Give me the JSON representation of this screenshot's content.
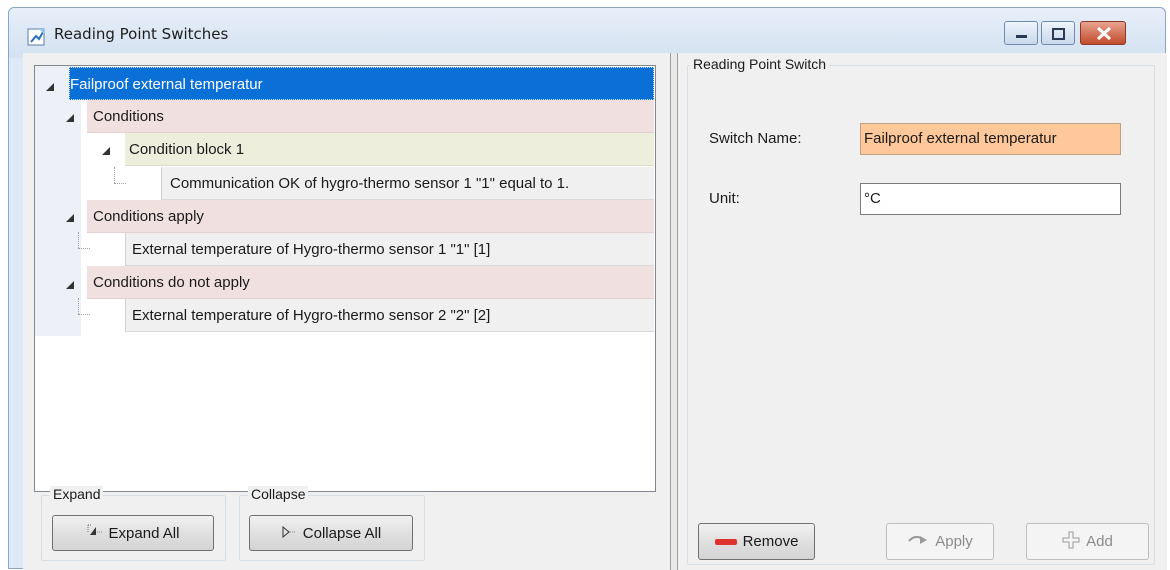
{
  "window": {
    "title": "Reading Point Switches",
    "colors": {
      "selection": "#0a6fd6",
      "condition_row": "#f1e0e0",
      "block_row": "#eeeedd",
      "name_highlight": "#ffc89a"
    }
  },
  "tree": {
    "root": "Failproof external temperatur",
    "conditions": "Conditions",
    "condition_block": "Condition block 1",
    "condition_item": "Communication OK of hygro-thermo sensor 1 \"1\" equal to 1.",
    "conditions_apply": "Conditions apply",
    "apply_item": "External temperature of Hygro-thermo sensor 1 \"1\" [1]",
    "conditions_not_apply": "Conditions do not apply",
    "not_apply_item": "External temperature of Hygro-thermo sensor 2 \"2\" [2]"
  },
  "expand_group": {
    "title": "Expand",
    "button": "Expand All"
  },
  "collapse_group": {
    "title": "Collapse",
    "button": "Collapse All"
  },
  "detail": {
    "group_title": "Reading Point Switch",
    "switch_name_label": "Switch Name:",
    "switch_name_value": "Failproof external temperatur",
    "unit_label": "Unit:",
    "unit_value": "°C"
  },
  "actions": {
    "remove": "Remove",
    "apply": "Apply",
    "add": "Add"
  }
}
